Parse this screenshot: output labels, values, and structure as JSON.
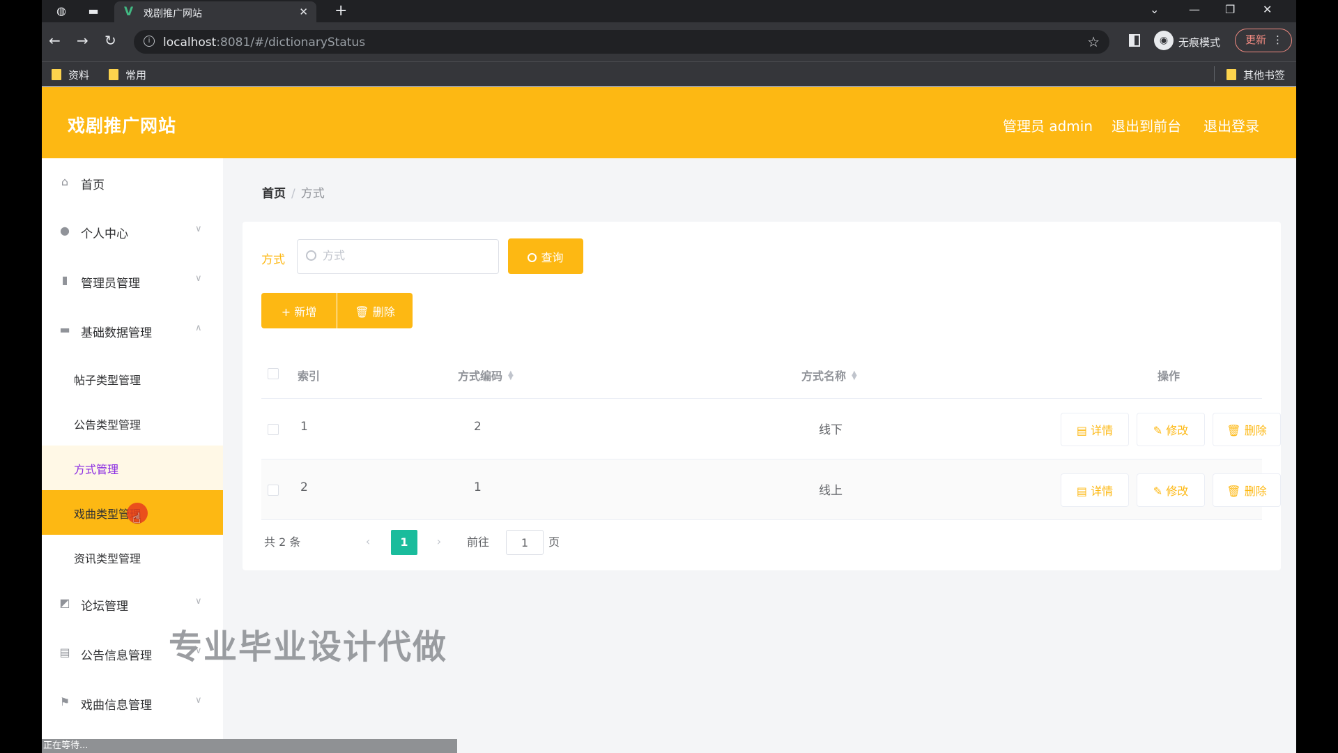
{
  "browser": {
    "tab_title": "戏剧推广网站",
    "url_host": "localhost",
    "url_rest": ":8081/#/dictionaryStatus",
    "incognito_label": "无痕模式",
    "update_label": "更新",
    "bookmarks": [
      "资料",
      "常用"
    ],
    "other_bookmarks": "其他书签"
  },
  "header": {
    "brand": "戏剧推广网站",
    "user": "管理员 admin",
    "to_front": "退出到前台",
    "logout": "退出登录"
  },
  "sidebar": {
    "items": [
      {
        "label": "首页"
      },
      {
        "label": "个人中心"
      },
      {
        "label": "管理员管理"
      },
      {
        "label": "基础数据管理"
      },
      {
        "label": "论坛管理"
      },
      {
        "label": "公告信息管理"
      },
      {
        "label": "戏曲信息管理"
      }
    ],
    "subitems": [
      {
        "label": "帖子类型管理"
      },
      {
        "label": "公告类型管理"
      },
      {
        "label": "方式管理"
      },
      {
        "label": "戏曲类型管理"
      },
      {
        "label": "资讯类型管理"
      }
    ]
  },
  "breadcrumb": {
    "home": "首页",
    "separator": "/",
    "current": "方式"
  },
  "search": {
    "label": "方式",
    "placeholder": "方式",
    "button": "查询"
  },
  "actions": {
    "add": "新增",
    "delete": "删除"
  },
  "table": {
    "columns": [
      "索引",
      "方式编码",
      "方式名称",
      "操作"
    ],
    "rows": [
      {
        "index": "1",
        "code": "2",
        "name": "线下"
      },
      {
        "index": "2",
        "code": "1",
        "name": "线上"
      }
    ],
    "ops": {
      "detail": "详情",
      "edit": "修改",
      "delete": "删除"
    }
  },
  "pagination": {
    "total": "共 2 条",
    "current_page": "1",
    "goto_label": "前往",
    "goto_value": "1",
    "page_suffix": "页"
  },
  "overlay": {
    "watermark": "专业毕业设计代做",
    "status": "正在等待..."
  },
  "colors": {
    "accent": "#fdb813",
    "pager_active": "#1abc9c",
    "menu_highlight": "#8a2be2"
  }
}
